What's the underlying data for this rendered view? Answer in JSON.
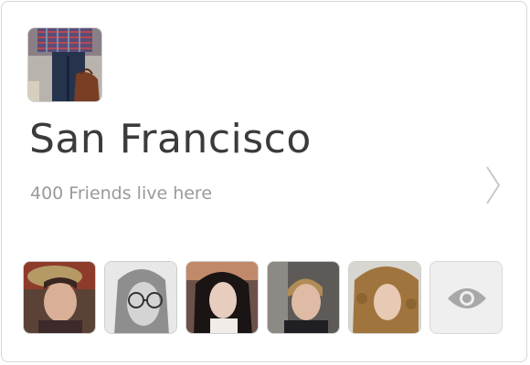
{
  "city": {
    "name": "San Francisco",
    "subtitle": "400 Friends live here",
    "thumbnail_icon": "city-photo-person-with-bag"
  },
  "friends": [
    {
      "icon": "friend-avatar-hat"
    },
    {
      "icon": "friend-avatar-glasses"
    },
    {
      "icon": "friend-avatar-dark-hair"
    },
    {
      "icon": "friend-avatar-blond"
    },
    {
      "icon": "friend-avatar-curly"
    }
  ],
  "actions": {
    "next_icon": "chevron-right-icon",
    "view_all_icon": "eye-icon"
  },
  "colors": {
    "title": "#3b3b3b",
    "subtitle": "#9a9a9a",
    "border": "#d6d6d6",
    "view_all_bg": "#efefef",
    "eye": "#a8a8a8"
  }
}
